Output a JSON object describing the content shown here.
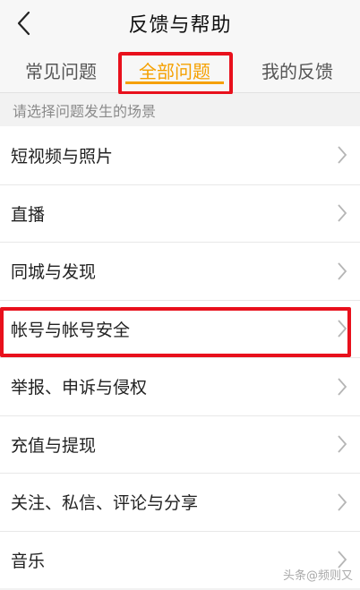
{
  "header": {
    "title": "反馈与帮助"
  },
  "tabs": [
    {
      "label": "常见问题"
    },
    {
      "label": "全部问题"
    },
    {
      "label": "我的反馈"
    }
  ],
  "hint": "请选择问题发生的场景",
  "items": [
    {
      "label": "短视频与照片"
    },
    {
      "label": "直播"
    },
    {
      "label": "同城与发现"
    },
    {
      "label": "帐号与帐号安全"
    },
    {
      "label": "举报、申诉与侵权"
    },
    {
      "label": "充值与提现"
    },
    {
      "label": "关注、私信、评论与分享"
    },
    {
      "label": "音乐"
    }
  ],
  "watermark": "头条@频则又",
  "colors": {
    "accent": "#f5a000",
    "highlight": "#e8101c"
  }
}
